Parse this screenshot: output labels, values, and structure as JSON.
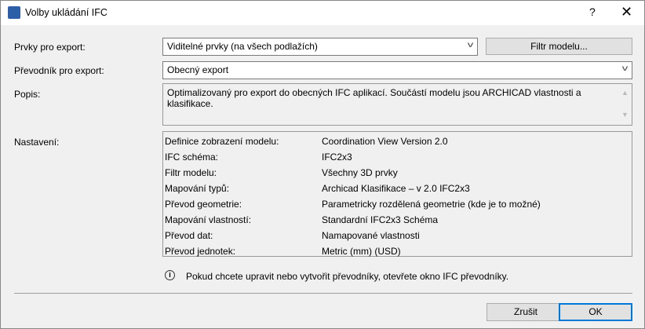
{
  "window": {
    "title": "Volby ukládání IFC",
    "help": "?",
    "close": "✕"
  },
  "export_elements": {
    "label": "Prvky pro export:",
    "value": "Viditelné prvky (na všech podlažích)",
    "filter_button": "Filtr modelu..."
  },
  "translator": {
    "label": "Převodník pro export:",
    "value": "Obecný export"
  },
  "description": {
    "label": "Popis:",
    "text": "Optimalizovaný pro export do obecných IFC aplikací. Součástí modelu jsou ARCHICAD vlastnosti a klasifikace."
  },
  "settings": {
    "label": "Nastavení:",
    "rows": [
      {
        "key": "Definice zobrazení modelu:",
        "value": "Coordination View Version 2.0"
      },
      {
        "key": "IFC schéma:",
        "value": "IFC2x3"
      },
      {
        "key": "Filtr modelu:",
        "value": "Všechny 3D prvky"
      },
      {
        "key": "Mapování typů:",
        "value": "Archicad Klasifikace – v 2.0 IFC2x3"
      },
      {
        "key": "Převod geometrie:",
        "value": "Parametricky rozdělená geometrie (kde je to možné)"
      },
      {
        "key": "Mapování vlastností:",
        "value": "Standardní IFC2x3 Schéma"
      },
      {
        "key": "Převod dat:",
        "value": "Namapované vlastnosti"
      },
      {
        "key": "Převod jednotek:",
        "value": "Metric (mm) (USD)"
      }
    ]
  },
  "info": "Pokud chcete upravit nebo vytvořit převodníky, otevřete okno IFC převodníky.",
  "buttons": {
    "cancel": "Zrušit",
    "ok": "OK"
  },
  "colors": {
    "accent": "#0078d7"
  }
}
